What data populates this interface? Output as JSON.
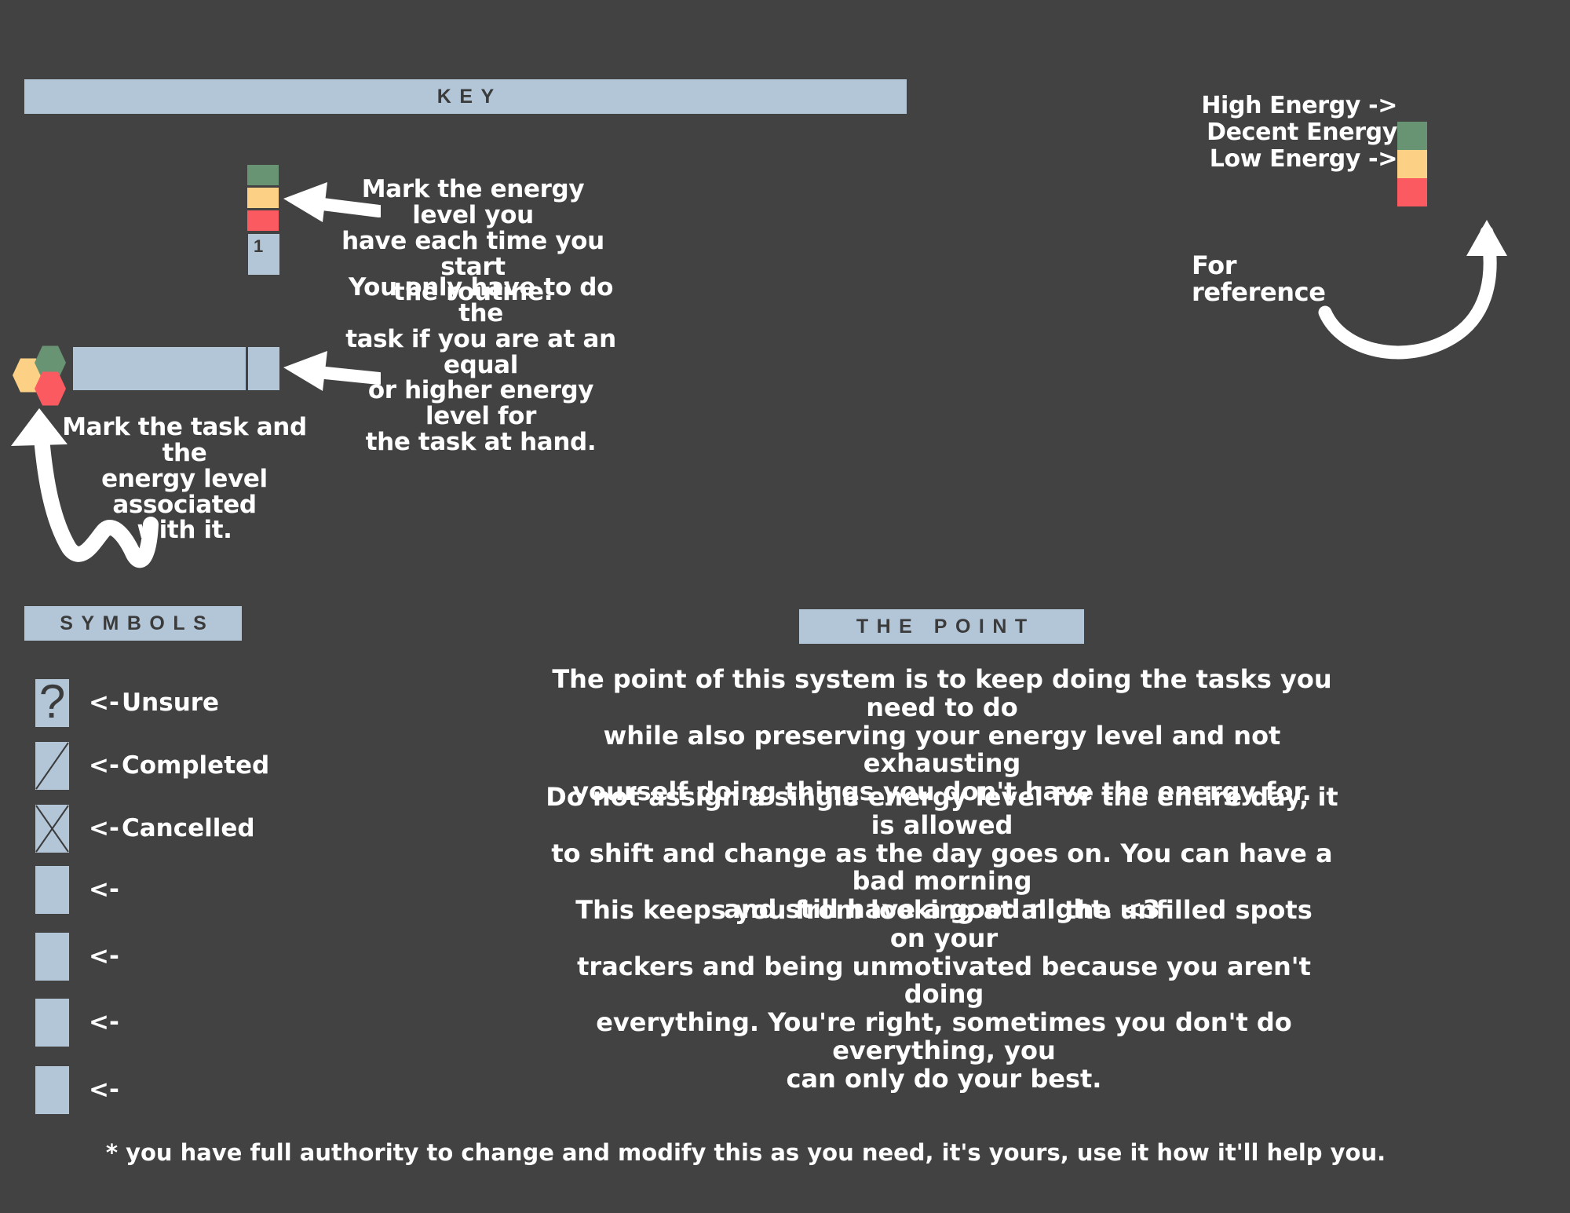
{
  "page": {
    "background_color": "#424242",
    "accent_color": "#b2c6d8",
    "text_color": "#ffffff"
  },
  "headers": {
    "key": "KEY",
    "symbols": "SYMBOLS",
    "the_point": "THE POINT"
  },
  "energy_colors": {
    "high": "#699473",
    "decent": "#fdd185",
    "low": "#fb5a60",
    "neutral": "#b2c6d8"
  },
  "reference_legend": {
    "rows": [
      {
        "label": "High Energy ->",
        "color": "#699473"
      },
      {
        "label": "Decent Energy ->",
        "color": "#fdd185"
      },
      {
        "label": "Low Energy ->",
        "color": "#fb5a60"
      }
    ],
    "caption": "For reference"
  },
  "key_diagram": {
    "energy_stack": [
      {
        "name": "high-energy-swatch",
        "color": "#699473"
      },
      {
        "name": "decent-energy-swatch",
        "color": "#fdd185"
      },
      {
        "name": "low-energy-swatch",
        "color": "#fb5a60"
      }
    ],
    "number_cell": "1",
    "annotations": [
      "Mark the energy level you\nhave each time you start\nthe routine.",
      "You only have to do the\ntask if you are at an equal\nor higher energy level for\nthe task at hand.",
      "Mark the task and the\nenergy level associated\nwith it."
    ],
    "task_row": {
      "hexagons": [
        {
          "name": "decent-energy-hexagon",
          "color": "#fdd185"
        },
        {
          "name": "high-energy-hexagon",
          "color": "#699473"
        },
        {
          "name": "low-energy-hexagon",
          "color": "#fb5a60"
        }
      ],
      "task_label": "",
      "checkbox_label": ""
    }
  },
  "symbols": {
    "items": [
      {
        "glyph": "question-mark",
        "arrow": "<-",
        "label": "Unsure"
      },
      {
        "glyph": "slash",
        "arrow": "<-",
        "label": "Completed"
      },
      {
        "glyph": "cross",
        "arrow": "<-",
        "label": "Cancelled"
      },
      {
        "glyph": "blank",
        "arrow": "<-",
        "label": ""
      },
      {
        "glyph": "blank",
        "arrow": "<-",
        "label": ""
      },
      {
        "glyph": "blank",
        "arrow": "<-",
        "label": ""
      },
      {
        "glyph": "blank",
        "arrow": "<-",
        "label": ""
      }
    ]
  },
  "the_point": {
    "paragraphs": [
      "The point of this system is to keep doing the tasks you need to do\nwhile also preserving your energy level and not exhausting\nyourself doing things you don't have the energy for.",
      "Do not assign a single energy level for the entire day, it is allowed\nto shift and change as the day goes on. You can have a bad morning\nand still have a good night. <3",
      "This keeps you from looking at all the unfilled spots on your\ntrackers and being unmotivated because you aren't doing\neverything. You're right, sometimes you don't do everything, you\ncan only do your best."
    ]
  },
  "footnote": "* you have full authority to change and modify this as you need, it's yours, use it how it'll help you."
}
